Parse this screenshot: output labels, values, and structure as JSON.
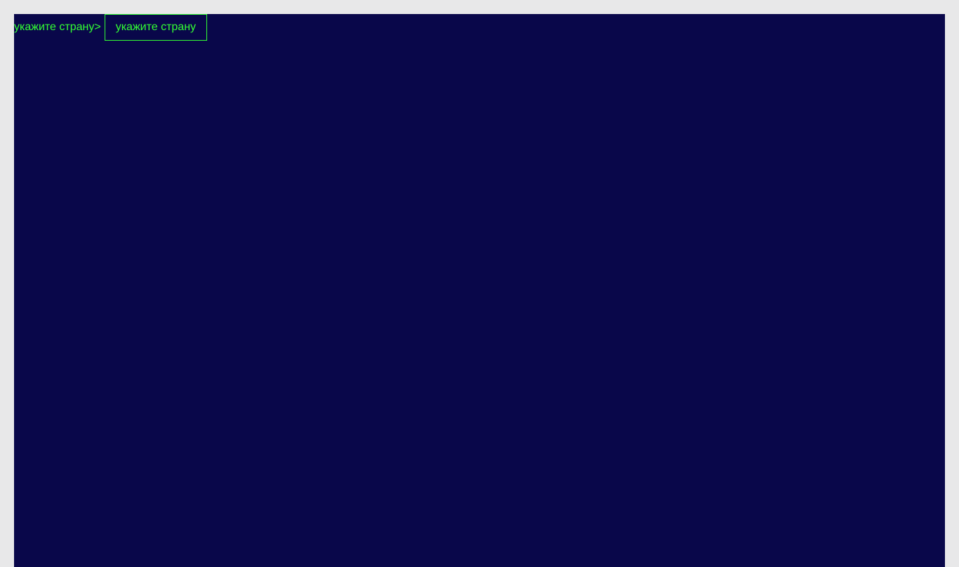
{
  "prompt": {
    "label": "укажите страну>",
    "button_label": "укажите страну"
  },
  "colors": {
    "page_background": "#e8e8e9",
    "terminal_background": "#09074a",
    "text_accent": "#33ff33"
  }
}
